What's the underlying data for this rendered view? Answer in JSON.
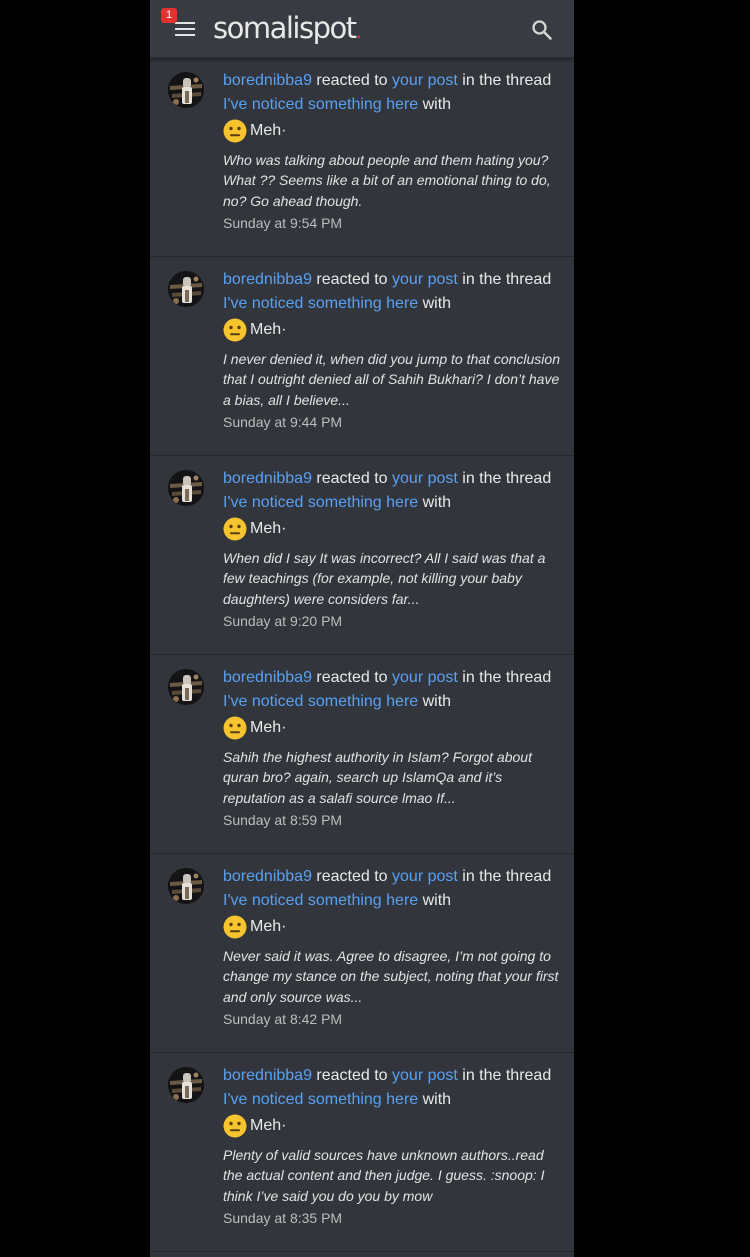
{
  "header": {
    "logo_text": "somalispot",
    "logo_dot": ".",
    "notification_count": "1",
    "accent_color": "#5aa0f1",
    "badge_color": "#e0322e"
  },
  "alerts": [
    {
      "user": "borednibba9",
      "reacted_to": " reacted to ",
      "post_link": "your post",
      "in_the_thread": " in the thread ",
      "thread_title": "I've noticed something here",
      "with": " with",
      "reaction": "Meh",
      "reaction_suffix": "·",
      "snippet": "Who was talking about people and them hating you? What ?? Seems like a bit of an emotional thing to do, no? Go ahead though.",
      "time": "Sunday at 9:54 PM"
    },
    {
      "user": "borednibba9",
      "reacted_to": " reacted to ",
      "post_link": "your post",
      "in_the_thread": " in the thread ",
      "thread_title": "I've noticed something here",
      "with": " with",
      "reaction": "Meh",
      "reaction_suffix": "·",
      "snippet": "I never denied it, when did you jump to that conclusion that I outright denied all of Sahih Bukhari? I don’t have a bias, all I believe...",
      "time": "Sunday at 9:44 PM"
    },
    {
      "user": "borednibba9",
      "reacted_to": " reacted to ",
      "post_link": "your post",
      "in_the_thread": " in the thread ",
      "thread_title": "I've noticed something here",
      "with": " with",
      "reaction": "Meh",
      "reaction_suffix": "·",
      "snippet": "When did I say It was incorrect? All I said was that a few teachings (for example, not killing your baby daughters) were considers far...",
      "time": "Sunday at 9:20 PM"
    },
    {
      "user": "borednibba9",
      "reacted_to": " reacted to ",
      "post_link": "your post",
      "in_the_thread": " in the thread ",
      "thread_title": "I've noticed something here",
      "with": " with",
      "reaction": "Meh",
      "reaction_suffix": "·",
      "snippet": "Sahih the highest authority in Islam? Forgot about quran bro? again, search up IslamQa and it’s reputation as a salafi source lmao If...",
      "time": "Sunday at 8:59 PM"
    },
    {
      "user": "borednibba9",
      "reacted_to": " reacted to ",
      "post_link": "your post",
      "in_the_thread": " in the thread ",
      "thread_title": "I've noticed something here",
      "with": " with",
      "reaction": "Meh",
      "reaction_suffix": "·",
      "snippet": "Never said it was. Agree to disagree, I’m not going to change my stance on the subject, noting that your first and only source was...",
      "time": "Sunday at 8:42 PM"
    },
    {
      "user": "borednibba9",
      "reacted_to": " reacted to ",
      "post_link": "your post",
      "in_the_thread": " in the thread ",
      "thread_title": "I've noticed something here",
      "with": " with",
      "reaction": "Meh",
      "reaction_suffix": "·",
      "snippet": "Plenty of valid sources have unknown authors..read the actual content and then judge. I guess. :snoop: I think I’ve said you do you by mow",
      "time": "Sunday at 8:35 PM"
    }
  ]
}
